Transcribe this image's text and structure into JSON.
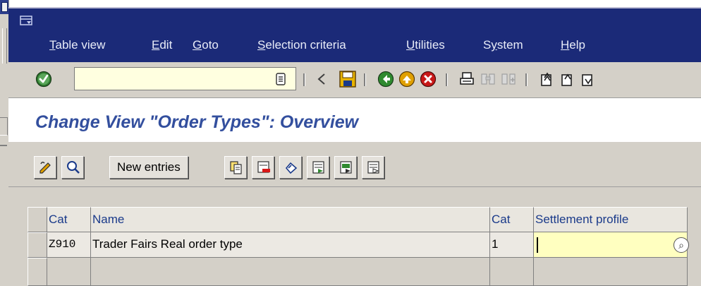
{
  "menu": {
    "items": [
      {
        "label": "Table view",
        "key": "T"
      },
      {
        "label": "Edit",
        "key": "E"
      },
      {
        "label": "Goto",
        "key": "G"
      },
      {
        "label": "Selection criteria",
        "key": "S"
      },
      {
        "label": "Utilities",
        "key": "U"
      },
      {
        "label": "System",
        "key": "y"
      },
      {
        "label": "Help",
        "key": "H"
      }
    ]
  },
  "toolbar": {
    "command_field_value": "",
    "icons": [
      "enter-icon",
      "command-dropdown-icon",
      "collapse-icon",
      "save-icon",
      "back-icon",
      "exit-icon",
      "cancel-icon",
      "print-icon",
      "find-icon",
      "find-next-icon",
      "first-page-icon",
      "previous-page-icon",
      "next-page-icon"
    ]
  },
  "page": {
    "title": "Change View \"Order Types\": Overview"
  },
  "app_toolbar": {
    "new_entries_label": "New entries",
    "icons": [
      "display-change-icon",
      "display-details-icon",
      "copy-as-icon",
      "delete-icon",
      "undo-change-icon",
      "select-all-icon",
      "select-block-icon",
      "deselect-all-icon"
    ]
  },
  "table": {
    "columns": [
      "Cat",
      "Name",
      "Cat",
      "Settlement profile"
    ],
    "rows": [
      {
        "cat": "Z910",
        "name": "Trader Fairs Real order type",
        "cat2": "1",
        "settlement_profile": ""
      }
    ]
  },
  "colors": {
    "menu_bar": "#1b2a78",
    "title_text": "#334f9e",
    "toolbar_bg": "#d4d0c8",
    "input_bg": "#ffffc0"
  }
}
